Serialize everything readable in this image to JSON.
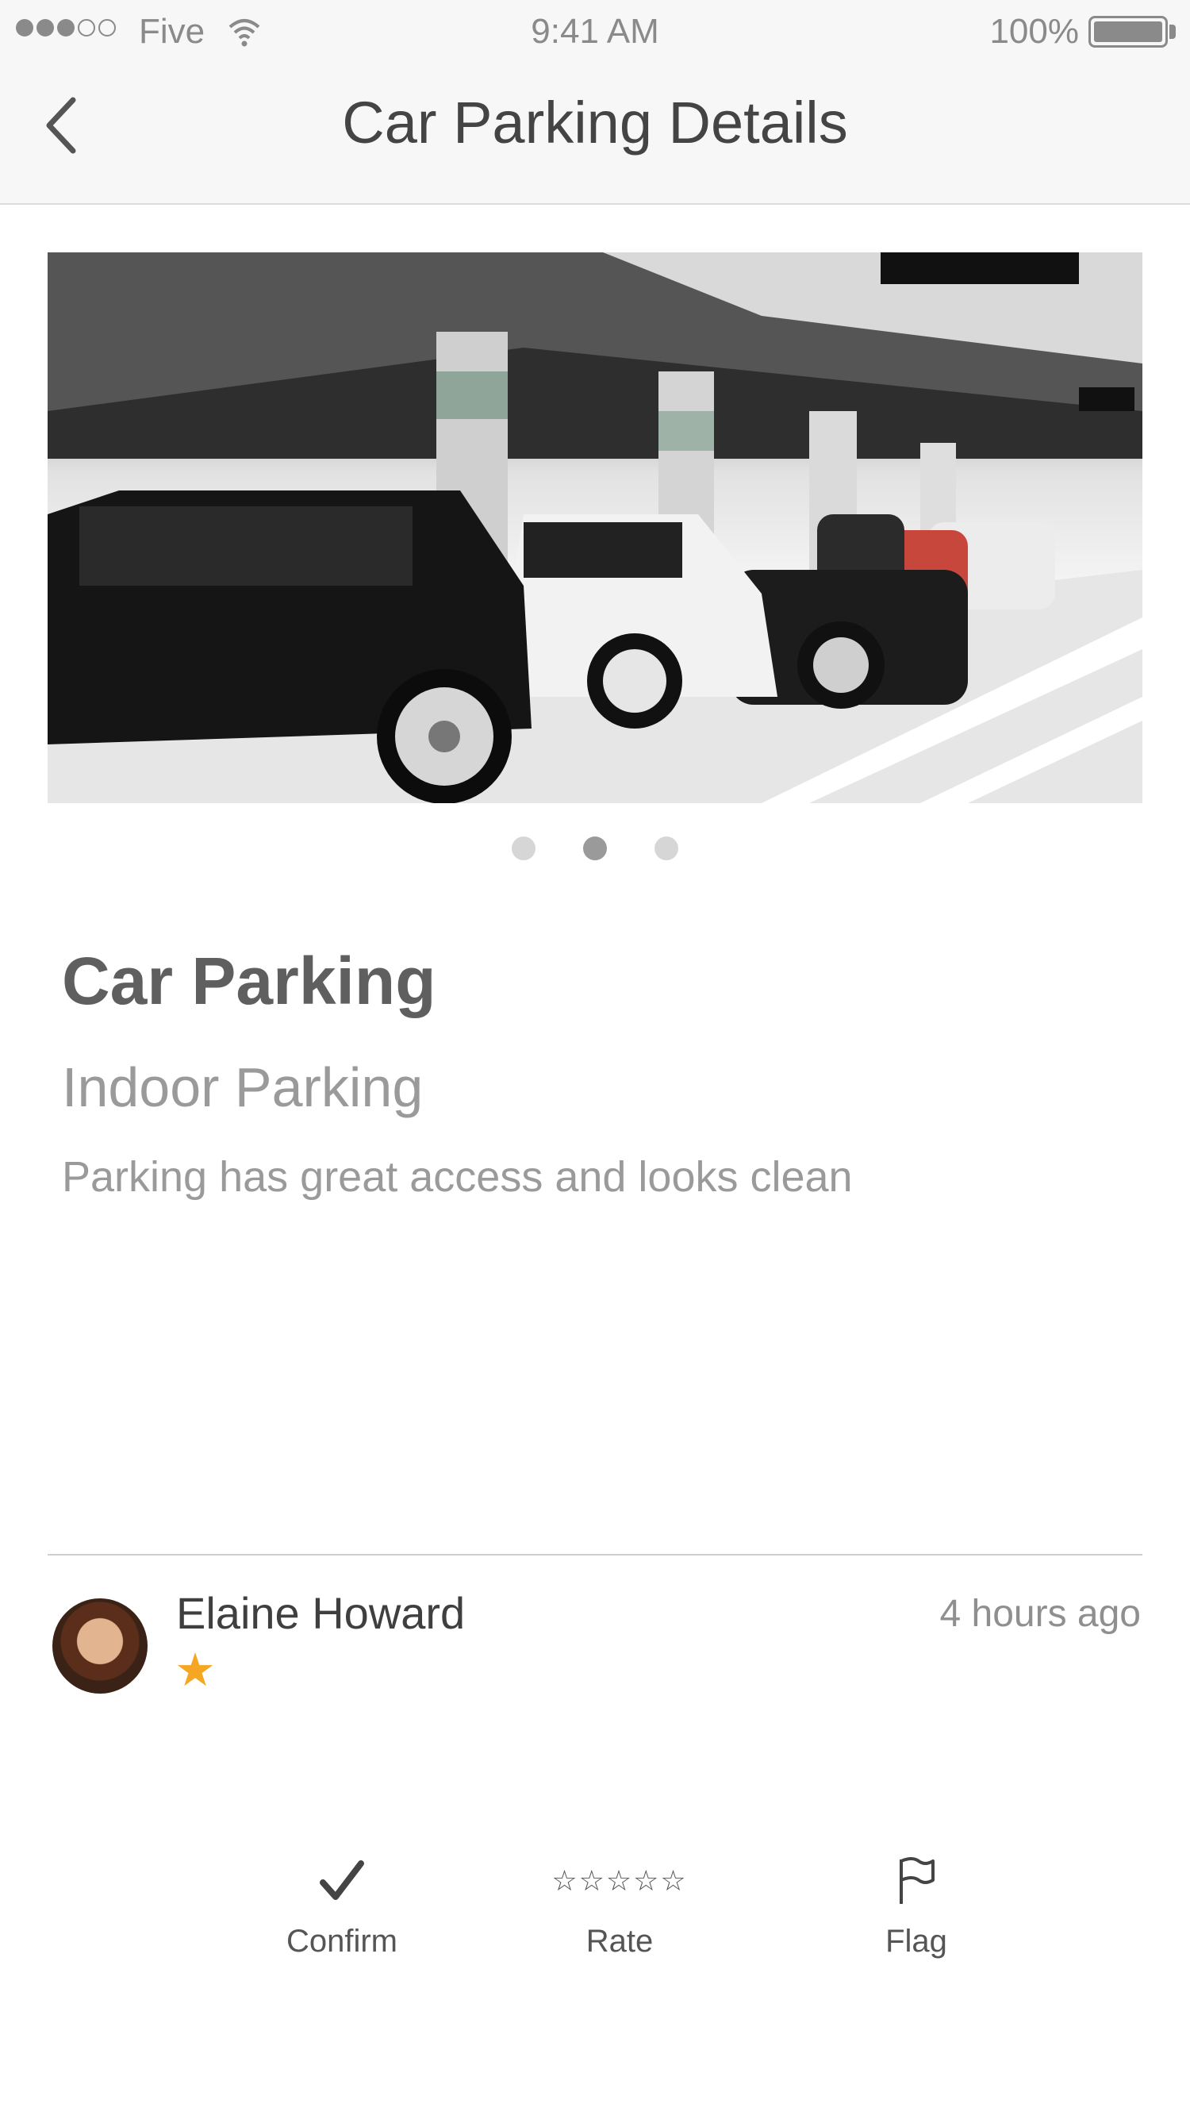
{
  "status_bar": {
    "carrier": "Five",
    "time": "9:41 AM",
    "battery": "100%",
    "signal_bars_filled": 3,
    "signal_bars_total": 5
  },
  "nav": {
    "title": "Car Parking Details",
    "back_icon": "chevron-left-icon"
  },
  "gallery": {
    "page_count": 3,
    "active_index": 1
  },
  "details": {
    "title": "Car Parking",
    "subtitle": "Indoor Parking",
    "description": "Parking has great access and looks clean"
  },
  "review": {
    "name": "Elaine Howard",
    "time": "4 hours ago",
    "rating_icon": "★",
    "star_color": "#f5a623"
  },
  "actions": {
    "confirm_label": "Confirm",
    "rate_label": "Rate",
    "flag_label": "Flag",
    "rate_stars": "☆☆☆☆☆"
  }
}
